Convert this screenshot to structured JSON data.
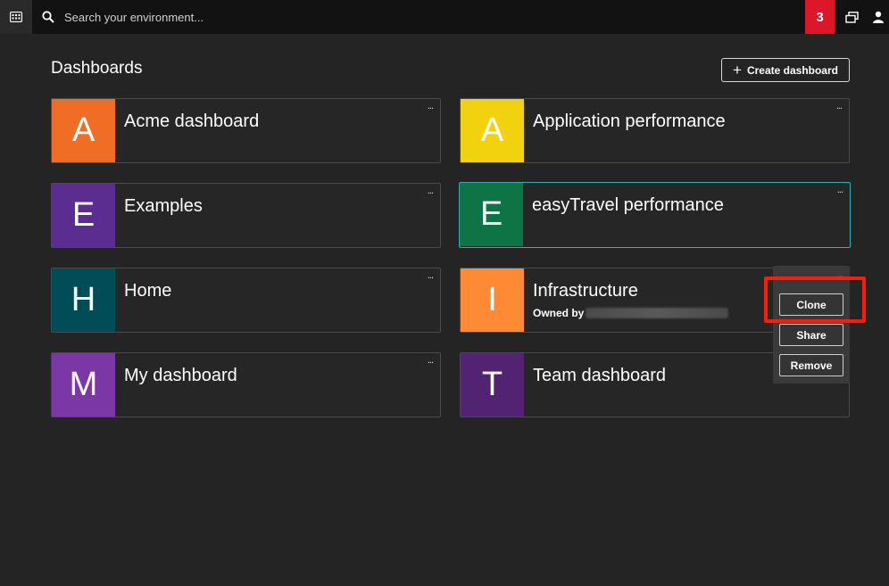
{
  "topbar": {
    "search_placeholder": "Search your environment...",
    "notification_count": "3"
  },
  "page": {
    "title": "Dashboards",
    "create_button_label": "Create dashboard"
  },
  "dashboards": [
    {
      "letter": "A",
      "name": "Acme dashboard",
      "color": "#f06d25"
    },
    {
      "letter": "A",
      "name": "Application performance",
      "color": "#f2d20e"
    },
    {
      "letter": "E",
      "name": "Examples",
      "color": "#5c2d91"
    },
    {
      "letter": "E",
      "name": "easyTravel performance",
      "color": "#0e7345"
    },
    {
      "letter": "H",
      "name": "Home",
      "color": "#004d57"
    },
    {
      "letter": "I",
      "name": "Infrastructure",
      "color": "#ff8a35",
      "owner_label": "Owned by"
    },
    {
      "letter": "M",
      "name": "My dashboard",
      "color": "#7b37a6"
    },
    {
      "letter": "T",
      "name": "Team dashboard",
      "color": "#522273"
    }
  ],
  "tile_more_label": "...",
  "context_menu": {
    "clone": "Clone",
    "share": "Share",
    "remove": "Remove"
  },
  "colors": {
    "background": "#242424",
    "topbar": "#121212",
    "notification": "#dc172a",
    "highlight_border": "#2ab0ad",
    "callout": "#ff1a0a"
  }
}
